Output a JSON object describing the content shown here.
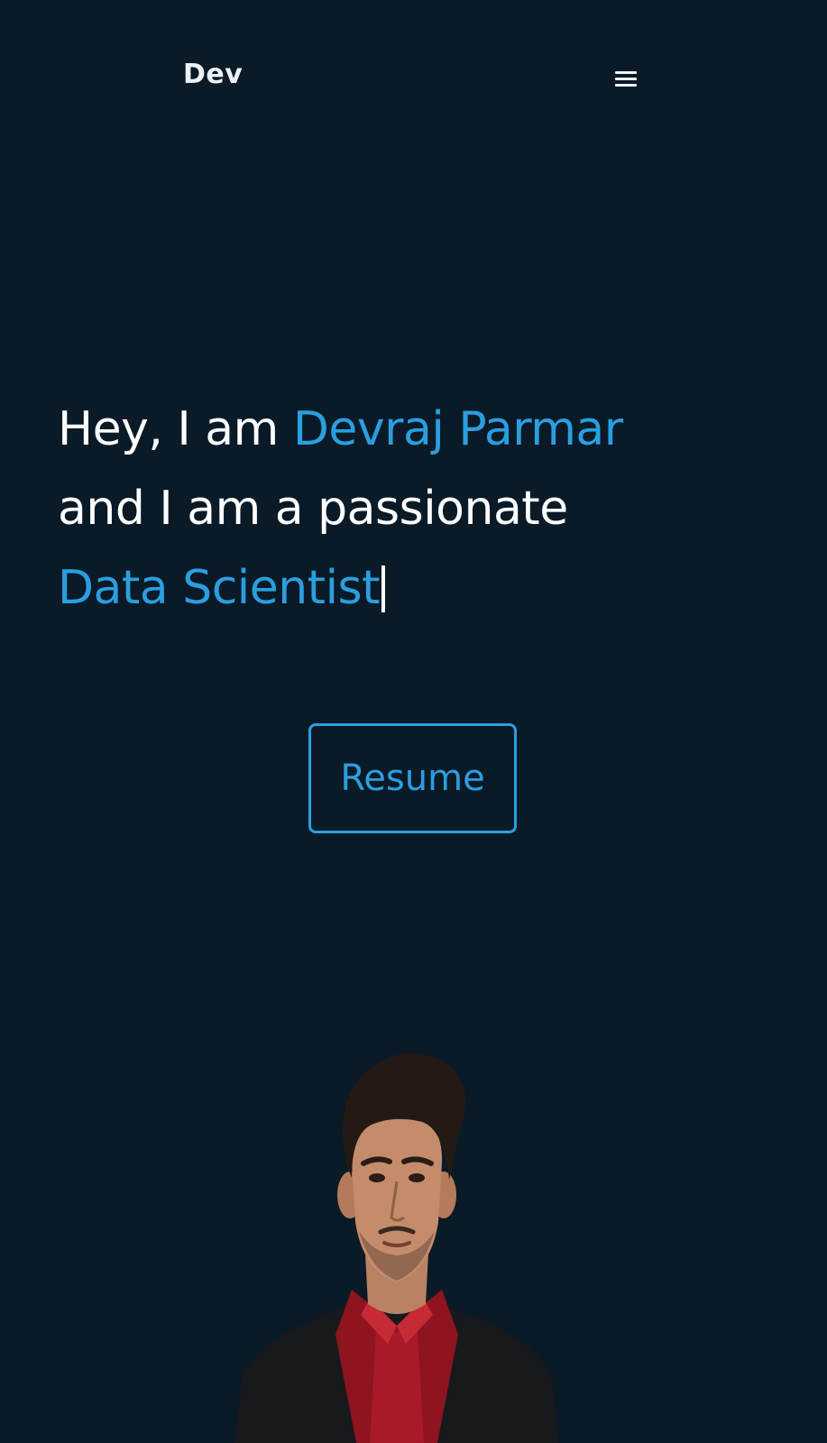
{
  "nav": {
    "logo": "Dev",
    "menu_icon": "hamburger-menu-icon"
  },
  "hero": {
    "line1_prefix": "Hey, I am ",
    "line1_name": "Devraj Parmar",
    "line2": "and I am a passionate",
    "line3_role": "Data Scientist"
  },
  "resume": {
    "label": "Resume"
  },
  "colors": {
    "background": "#0b1a27",
    "accent": "#2a9fe0",
    "text": "#ffffff"
  }
}
